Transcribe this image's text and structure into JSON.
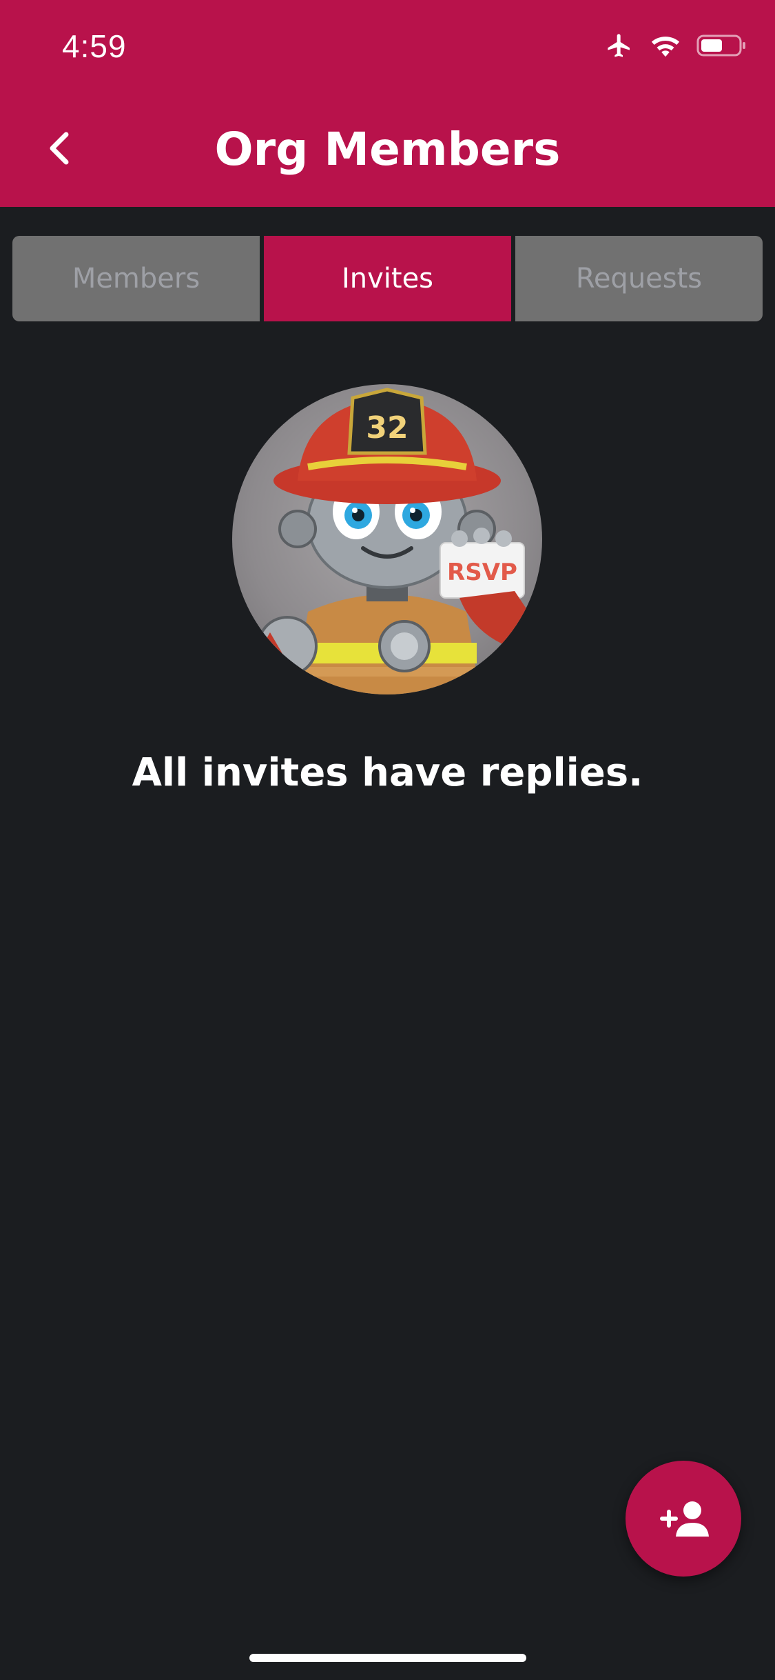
{
  "status_bar": {
    "time": "4:59",
    "icons": [
      "airplane-icon",
      "wifi-icon",
      "battery-icon"
    ]
  },
  "header": {
    "title": "Org Members",
    "back_icon": "chevron-left-icon"
  },
  "tabs": [
    {
      "label": "Members",
      "active": false
    },
    {
      "label": "Invites",
      "active": true
    },
    {
      "label": "Requests",
      "active": false
    }
  ],
  "empty_state": {
    "illustration_badge": "32",
    "illustration_card": "RSVP",
    "message": "All invites have replies."
  },
  "fab": {
    "icon": "add-person-icon"
  },
  "colors": {
    "brand": "#b8124b",
    "background": "#1b1d20",
    "tab_inactive": "#717171",
    "tab_inactive_text": "#9ea0a6"
  }
}
